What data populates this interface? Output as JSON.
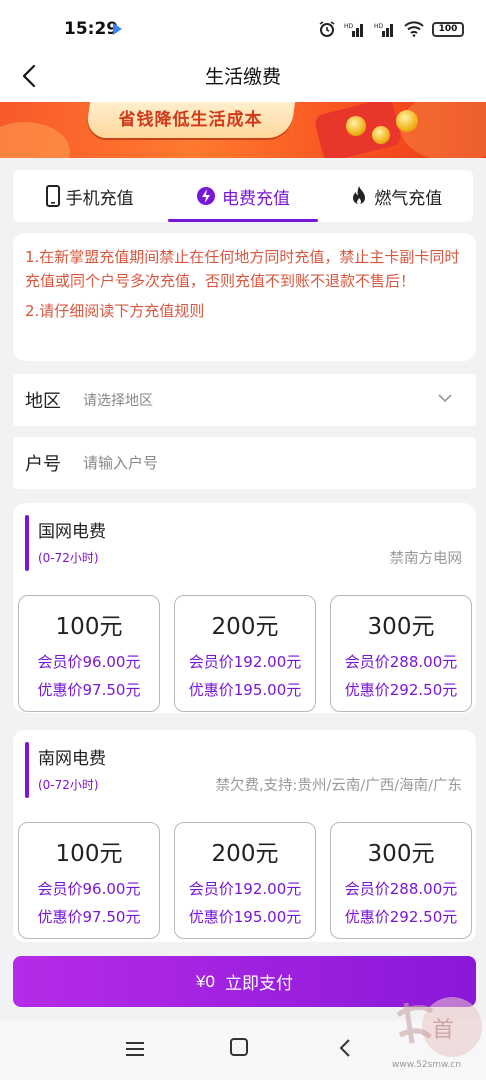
{
  "status": {
    "time": "15:29",
    "battery": "100"
  },
  "header": {
    "title": "生活缴费"
  },
  "banner": {
    "text": "省钱降低生活成本"
  },
  "tabs": [
    {
      "label": "手机充值",
      "icon": "phone-icon",
      "active": false
    },
    {
      "label": "电费充值",
      "icon": "lightning-icon",
      "active": true
    },
    {
      "label": "燃气充值",
      "icon": "flame-icon",
      "active": false
    }
  ],
  "notice": {
    "line1": "1.在新掌盟充值期间禁止在任何地方同时充值，禁止主卡副卡同时充值或同个户号多次充值，否则充值不到账不退款不售后！",
    "line2": "2.请仔细阅读下方充值规则"
  },
  "form": {
    "region": {
      "label": "地区",
      "placeholder": "请选择地区"
    },
    "account": {
      "label": "户号",
      "placeholder": "请输入户号"
    }
  },
  "cards": [
    {
      "title": "国网电费",
      "subtitle": "(0-72小时)",
      "note": "禁南方电网",
      "options": [
        {
          "amount": "100元",
          "member": "会员价96.00元",
          "discount": "优惠价97.50元"
        },
        {
          "amount": "200元",
          "member": "会员价192.00元",
          "discount": "优惠价195.00元"
        },
        {
          "amount": "300元",
          "member": "会员价288.00元",
          "discount": "优惠价292.50元"
        }
      ]
    },
    {
      "title": "南网电费",
      "subtitle": "(0-72小时)",
      "note": "禁欠费,支持:贵州/云南/广西/海南/广东",
      "options": [
        {
          "amount": "100元",
          "member": "会员价96.00元",
          "discount": "优惠价97.50元"
        },
        {
          "amount": "200元",
          "member": "会员价192.00元",
          "discount": "优惠价195.00元"
        },
        {
          "amount": "300元",
          "member": "会员价288.00元",
          "discount": "优惠价292.50元"
        }
      ]
    }
  ],
  "pay": {
    "amount": "¥0",
    "label": "立即支付"
  },
  "watermark": {
    "url": "www.52smw.cn"
  },
  "colors": {
    "accent": "#7a16d6",
    "notice": "#d9573f",
    "banner": "#f85a2a"
  }
}
